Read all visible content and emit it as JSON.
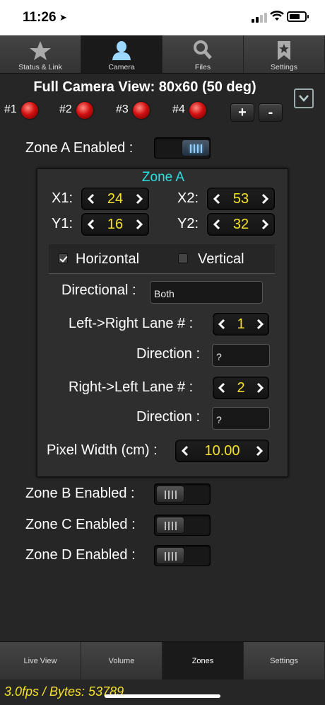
{
  "status": {
    "time": "11:26",
    "location_glyph": "➤"
  },
  "top_tabs": [
    {
      "label": "Status & Link",
      "icon": "star-icon"
    },
    {
      "label": "Camera",
      "icon": "person-icon",
      "active": true
    },
    {
      "label": "Files",
      "icon": "magnifier-icon"
    },
    {
      "label": "Settings",
      "icon": "bookmark-star-icon"
    }
  ],
  "header": {
    "title": "Full Camera View: 80x60 (50 deg)"
  },
  "leds": [
    {
      "label": "#1"
    },
    {
      "label": "#2"
    },
    {
      "label": "#3"
    },
    {
      "label": "#4"
    }
  ],
  "buttons": {
    "plus": "+",
    "minus": "-"
  },
  "zone_a": {
    "enabled_label": "Zone A Enabled :",
    "enabled": true,
    "title": "Zone A",
    "x1_label": "X1:",
    "x1": "24",
    "x2_label": "X2:",
    "x2": "53",
    "y1_label": "Y1:",
    "y1": "16",
    "y2_label": "Y2:",
    "y2": "32",
    "horizontal_label": "Horizontal",
    "horizontal_checked": true,
    "vertical_label": "Vertical",
    "vertical_checked": false,
    "directional_label": "Directional :",
    "directional_value": "Both",
    "lr_lane_label": "Left->Right Lane # :",
    "lr_lane": "1",
    "lr_direction_label": "Direction :",
    "lr_direction": "?",
    "rl_lane_label": "Right->Left Lane # :",
    "rl_lane": "2",
    "rl_direction_label": "Direction :",
    "rl_direction": "?",
    "pixel_width_label": "Pixel Width (cm) :",
    "pixel_width": "10.00"
  },
  "zone_b": {
    "enabled_label": "Zone B Enabled :",
    "enabled": false
  },
  "zone_c": {
    "enabled_label": "Zone C Enabled :",
    "enabled": false
  },
  "zone_d": {
    "enabled_label": "Zone D Enabled :",
    "enabled": false
  },
  "bottom_tabs": [
    {
      "label": "Live View"
    },
    {
      "label": "Volume"
    },
    {
      "label": "Zones",
      "active": true
    },
    {
      "label": "Settings"
    }
  ],
  "footer": {
    "stats": "3.0fps / Bytes: 53789"
  },
  "colors": {
    "accent_yellow": "#f5e12a",
    "zone_title": "#2ae0e0",
    "led_red": "#d01010"
  }
}
